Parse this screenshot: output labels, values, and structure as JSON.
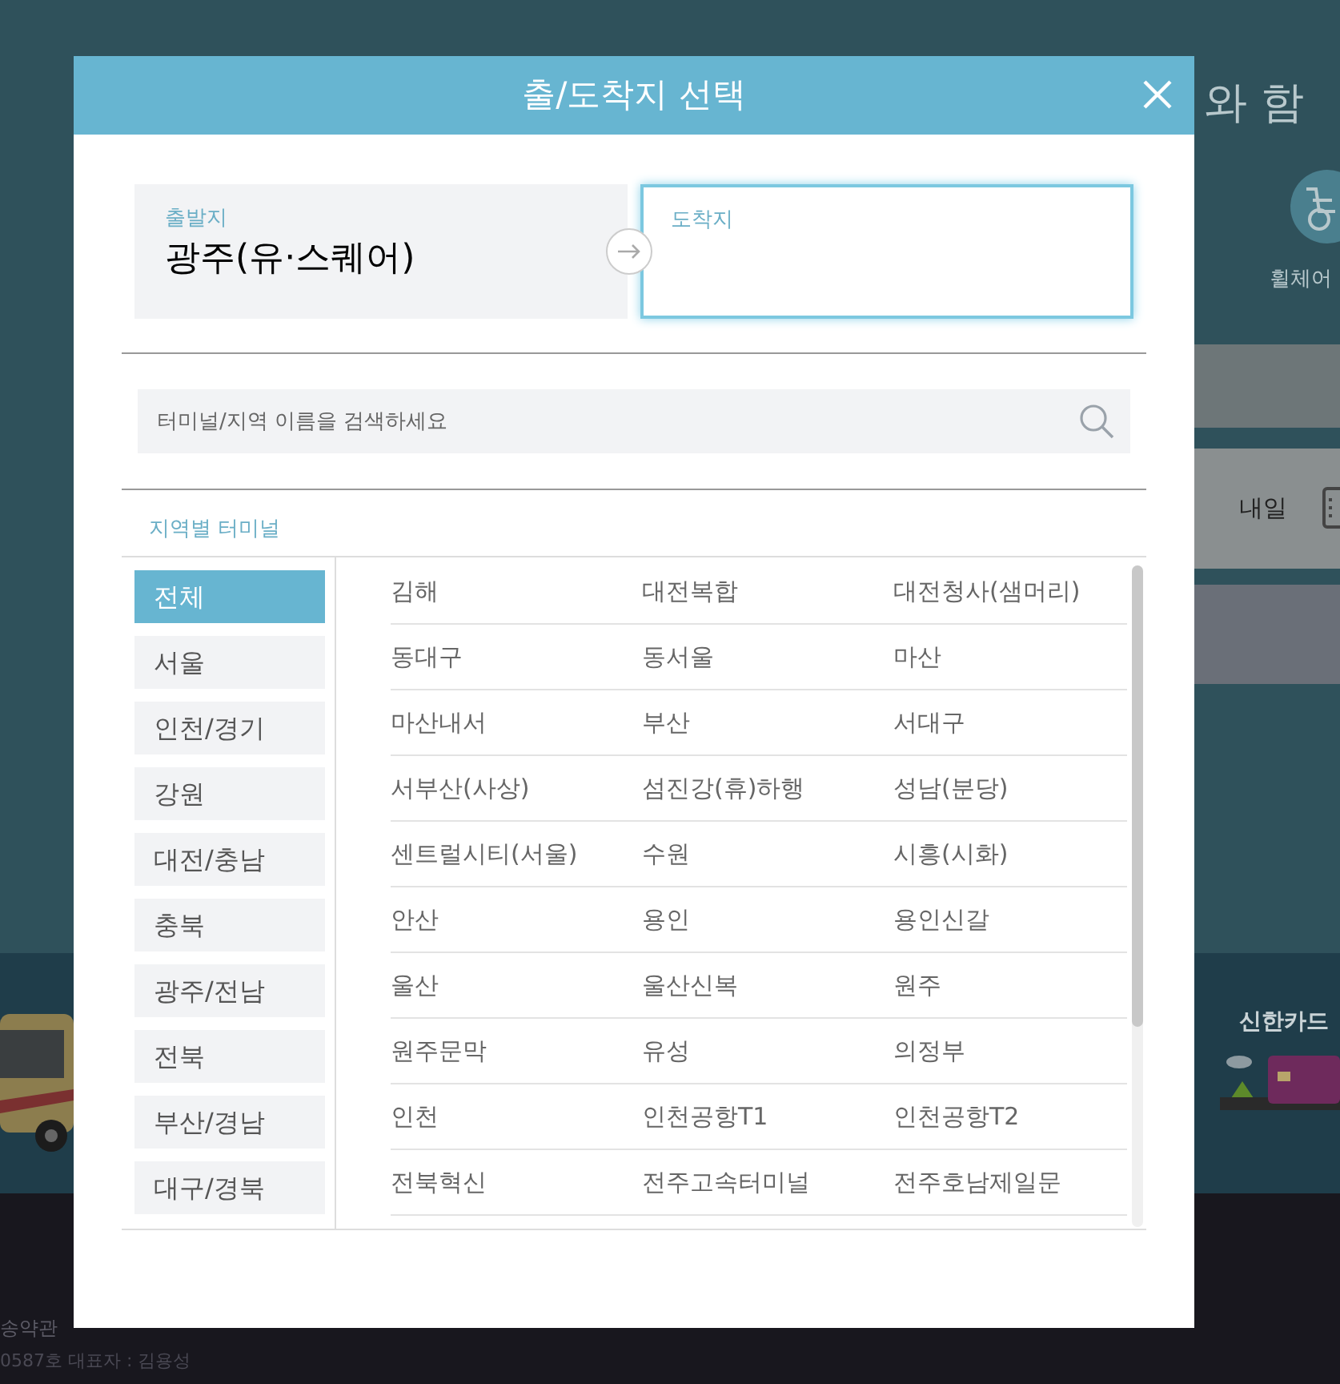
{
  "background": {
    "headline": "와 함",
    "wheelchair_label": "휠체어",
    "date_option": "내일",
    "card_promo": "신한카드",
    "footer_link": "송약관",
    "footer_info": "0587호 대표자 : 김용성"
  },
  "modal": {
    "title": "출/도착지 선택",
    "departure": {
      "label": "출발지",
      "value": "광주(유·스퀘어)",
      "selected": false
    },
    "arrival": {
      "label": "도착지",
      "selected": true
    },
    "search": {
      "placeholder": "터미널/지역 이름을 검색하세요"
    },
    "section_title": "지역별 터미널",
    "regions": [
      {
        "label": "전체",
        "selected": true
      },
      {
        "label": "서울",
        "selected": false
      },
      {
        "label": "인천/경기",
        "selected": false
      },
      {
        "label": "강원",
        "selected": false
      },
      {
        "label": "대전/충남",
        "selected": false
      },
      {
        "label": "충북",
        "selected": false
      },
      {
        "label": "광주/전남",
        "selected": false
      },
      {
        "label": "전북",
        "selected": false
      },
      {
        "label": "부산/경남",
        "selected": false
      },
      {
        "label": "대구/경북",
        "selected": false
      }
    ],
    "terminals": [
      "김해",
      "대전복합",
      "대전청사(샘머리)",
      "동대구",
      "동서울",
      "마산",
      "마산내서",
      "부산",
      "서대구",
      "서부산(사상)",
      "섬진강(휴)하행",
      "성남(분당)",
      "센트럴시티(서울)",
      "수원",
      "시흥(시화)",
      "안산",
      "용인",
      "용인신갈",
      "울산",
      "울산신복",
      "원주",
      "원주문막",
      "유성",
      "의정부",
      "인천",
      "인천공항T1",
      "인천공항T2",
      "전북혁신",
      "전주고속터미널",
      "전주호남제일문"
    ]
  }
}
